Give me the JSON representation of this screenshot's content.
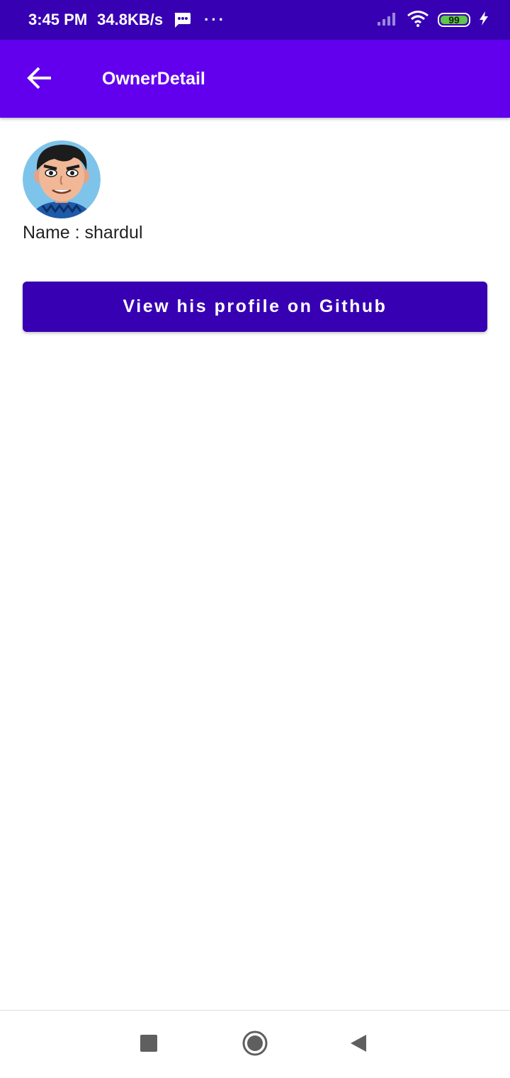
{
  "status_bar": {
    "time": "3:45 PM",
    "network_speed": "34.8KB/s",
    "notification_icon": "message-icon",
    "more_indicator": "···",
    "battery_level": "99",
    "icons": [
      "signal-icon",
      "wifi-icon",
      "battery-icon",
      "charging-icon"
    ]
  },
  "app_bar": {
    "title": "OwnerDetail",
    "back_icon": "arrow-back-icon"
  },
  "owner": {
    "name_line": "Name : shardul",
    "avatar_icon": "avatar-image"
  },
  "actions": {
    "github_button_label": "View his profile on Github"
  },
  "nav_bar": {
    "icons": [
      "recents-icon",
      "home-icon",
      "back-icon"
    ]
  },
  "colors": {
    "status_bar": "#3700b3",
    "app_bar": "#6200ee",
    "button": "#3700b3",
    "background": "#ffffff"
  }
}
